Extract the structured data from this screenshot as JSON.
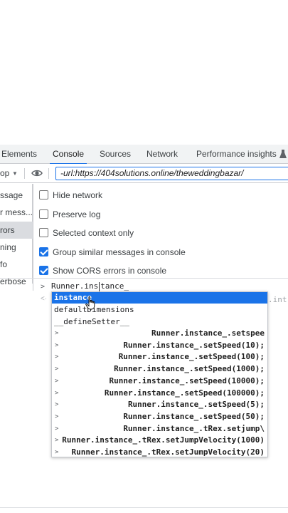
{
  "tabs": [
    {
      "label": "Elements",
      "active": false
    },
    {
      "label": "Console",
      "active": true
    },
    {
      "label": "Sources",
      "active": false
    },
    {
      "label": "Network",
      "active": false
    },
    {
      "label": "Performance insights",
      "active": false
    }
  ],
  "toolbar": {
    "context_label": "op",
    "filter_value": "-url:https://404solutions.online/theweddingbazar/"
  },
  "sidebar": {
    "items": [
      {
        "label": "ssage",
        "selected": false
      },
      {
        "label": "r mess...",
        "selected": false
      },
      {
        "label": "rors",
        "selected": true
      },
      {
        "label": "ning",
        "selected": false
      },
      {
        "label": "fo",
        "selected": false
      },
      {
        "label": "erbose",
        "selected": false
      }
    ]
  },
  "settings": {
    "options": [
      {
        "label": "Hide network",
        "checked": false
      },
      {
        "label": "Preserve log",
        "checked": false
      },
      {
        "label": "Selected context only",
        "checked": false
      },
      {
        "label": "Group similar messages in console",
        "checked": true
      },
      {
        "label": "Show CORS errors in console",
        "checked": true
      }
    ]
  },
  "console": {
    "input_before_cursor": "Runner.ins",
    "input_after_cursor": "tance_",
    "ghost_suffix": ".int"
  },
  "autocomplete": {
    "suggestions": [
      {
        "label": "instance",
        "selected": true
      },
      {
        "label": "defaultDimensions",
        "selected": false
      },
      {
        "label": "__defineSetter__",
        "selected": false
      }
    ],
    "history": [
      "Runner.instance_.setspee",
      "Runner.instance_.setSpeed(10);",
      "Runner.instance_.setSpeed(100);",
      "Runner.instance_.setSpeed(1000);",
      "Runner.instance_.setSpeed(10000);",
      "Runner.instance_.setSpeed(100000);",
      "Runner.instance_.setSpeed(5);",
      "Runner.instance_.setSpeed(50);",
      "Runner.instance_.tRex.setjump\\",
      "Runner.instance_.tRex.setJumpVelocity(1000)",
      "Runner.instance_.tRex.setJumpVelocity(20)"
    ]
  },
  "colors": {
    "accent": "#1a73e8",
    "selected_sidebar": "#dadce0"
  }
}
